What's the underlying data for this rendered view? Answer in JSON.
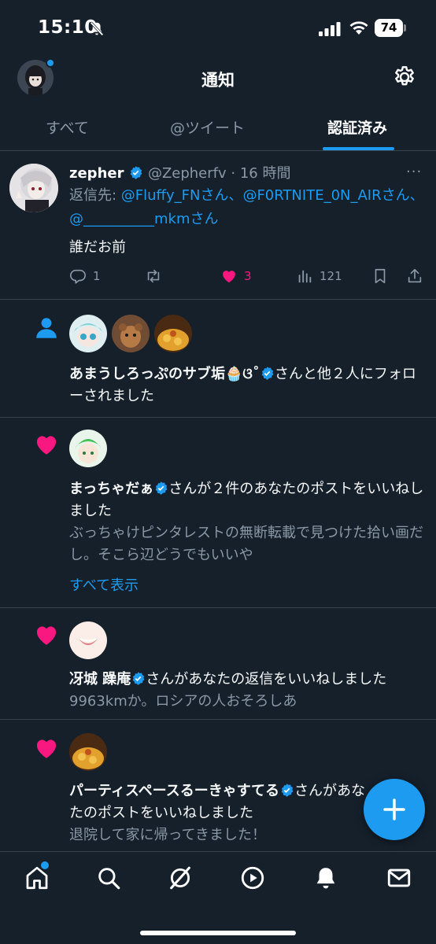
{
  "status_bar": {
    "time": "15:10",
    "battery": "74"
  },
  "header": {
    "title": "通知"
  },
  "tabs": [
    {
      "label": "すべて",
      "active": false
    },
    {
      "label": "@ツイート",
      "active": false
    },
    {
      "label": "認証済み",
      "active": true
    }
  ],
  "tweet": {
    "name": "zepher",
    "handle": "@Zepherfv",
    "time": "· 16 時間",
    "more": "···",
    "reply_prefix": "返信先: ",
    "reply_to_1": "@Fluffy_FN",
    "reply_sep_1": "さん、",
    "reply_to_2": "@F0RTNITE_0N_AIR",
    "reply_sep_2": "さん、",
    "reply_to_3": "@__________mkm",
    "reply_sep_3": "さん",
    "text": "誰だお前",
    "replies": "1",
    "likes": "3",
    "views": "121"
  },
  "notifications": [
    {
      "type": "follow",
      "name": "あまうしろっぷのサブ垢🧁ଓ˚",
      "text": "さんと他２人にフォローされました"
    },
    {
      "type": "like",
      "name": "まっちゃだぁ",
      "text": "さんが２件のあなたのポストをいいねしました",
      "sub": "ぶっちゃけピンタレストの無断転載で見つけた拾い画だし。そこら辺どうでもいいや",
      "link": "すべて表示"
    },
    {
      "type": "like",
      "name": "冴城 躁庵",
      "text": "さんがあなたの返信をいいねしました",
      "sub": "9963kmか。ロシアの人おそろしあ"
    },
    {
      "type": "like",
      "name": "パーティスペースるーきゃすてる",
      "text": "さんがあなたのポストをいいねしました",
      "sub": "退院して家に帰ってきました！"
    }
  ],
  "colors": {
    "accent": "#1d9bf0",
    "like": "#f91880",
    "background": "#15202b"
  }
}
